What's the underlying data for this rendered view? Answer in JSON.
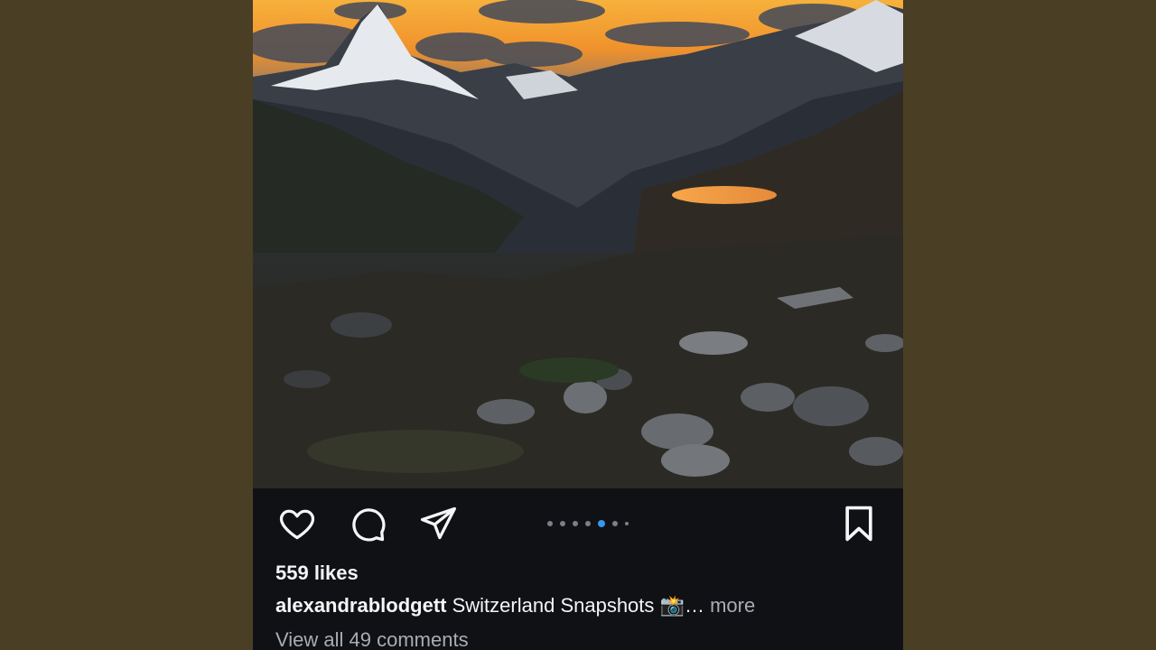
{
  "post": {
    "image_alt": "Matterhorn mountain at sunset with alpine lake and rocky terrain",
    "likes": "559 likes",
    "caption": {
      "username": "alexandrablodgett",
      "text": "Switzerland Snapshots",
      "emoji": "📸",
      "ellipsis": "…",
      "more": "more"
    },
    "comments_link": "View all 49 comments"
  },
  "actions": {
    "icons": [
      "heart-icon",
      "comment-icon",
      "share-icon",
      "bookmark-icon"
    ]
  },
  "carousel": {
    "dots": 7,
    "active_index": 4
  },
  "colors": {
    "background": "#4a3e24",
    "panel": "#0f1115",
    "active_dot": "#3797f0",
    "text": "#f5f5f5",
    "muted_text": "#a8acb3"
  }
}
